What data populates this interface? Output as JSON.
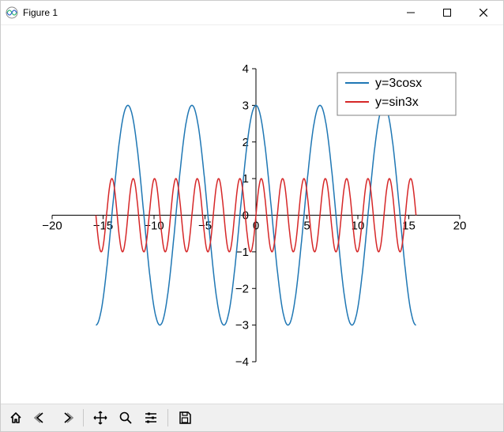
{
  "window": {
    "title": "Figure 1",
    "buttons": {
      "minimize": "Minimize",
      "maximize": "Maximize",
      "close": "Close"
    }
  },
  "toolbar": {
    "home": "Home",
    "back": "Back",
    "forward": "Forward",
    "pan": "Pan",
    "zoom": "Zoom",
    "configure": "Configure subplots",
    "save": "Save"
  },
  "chart_data": {
    "type": "line",
    "title": "",
    "xlabel": "",
    "ylabel": "",
    "xlim": [
      -20,
      20
    ],
    "ylim": [
      -4,
      4
    ],
    "xticks": [
      -20,
      -15,
      -10,
      -5,
      0,
      5,
      10,
      15,
      20
    ],
    "yticks": [
      -4,
      -3,
      -2,
      -1,
      0,
      1,
      2,
      3,
      4
    ],
    "xtick_labels": [
      "−20",
      "−15",
      "−10",
      "−5",
      "0",
      "5",
      "10",
      "15",
      "20"
    ],
    "ytick_labels": [
      "−4",
      "−3",
      "−2",
      "−1",
      "0",
      "1",
      "2",
      "3",
      "4"
    ],
    "legend": {
      "position": "upper right",
      "entries": [
        "y=3cosx",
        "y=sin3x"
      ]
    },
    "series": [
      {
        "name": "y=3cosx",
        "color": "#1f77b4",
        "fn": "3*cos(x)",
        "domain": [
          -15.70796,
          15.70796
        ]
      },
      {
        "name": "y=sin3x",
        "color": "#d62728",
        "fn": "sin(3*x)",
        "domain": [
          -15.70796,
          15.70796
        ]
      }
    ],
    "colors": {
      "axis": "#000000",
      "legend_border": "#808080"
    }
  }
}
